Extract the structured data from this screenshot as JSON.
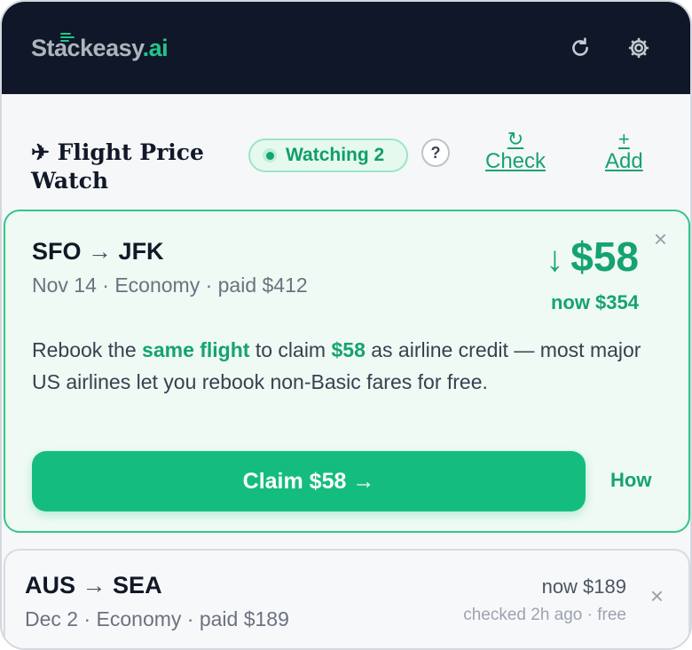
{
  "app": {
    "logo_main": "Stackeasy",
    "logo_suffix": ".ai",
    "refresh_icon": "refresh-icon",
    "settings_icon": "gear-icon"
  },
  "header": {
    "title": "✈ Flight Price Watch",
    "watching_label": "Watching 2",
    "help_label": "?",
    "check_symbol": "↻",
    "check_label": "Check",
    "add_symbol": "+",
    "add_label": "Add"
  },
  "alert": {
    "route_from": "SFO",
    "route_arrow": "→",
    "route_to": "JFK",
    "meta": "Nov 14 · Economy · paid $412",
    "drop_arrow": "↓",
    "drop_amount": "$58",
    "now_price": "now $354",
    "close": "×",
    "msg_1": "Rebook the ",
    "msg_2": "same flight",
    "msg_3": " to claim ",
    "msg_4": "$58",
    "msg_5": " as airline credit — most major US airlines let you rebook non-Basic fares for free.",
    "claim_label": "Claim $58 →",
    "how_label": "How"
  },
  "flight2": {
    "route_from": "AUS",
    "route_arrow": "→",
    "route_to": "SEA",
    "meta": "Dec 2 · Economy · paid $189",
    "now_price": "now $189",
    "checked": "checked 2h ago · free",
    "close": "×"
  },
  "colors": {
    "accent": "#16a36f",
    "topbar": "#0f1729",
    "alert_bg": "#eefaf3"
  }
}
